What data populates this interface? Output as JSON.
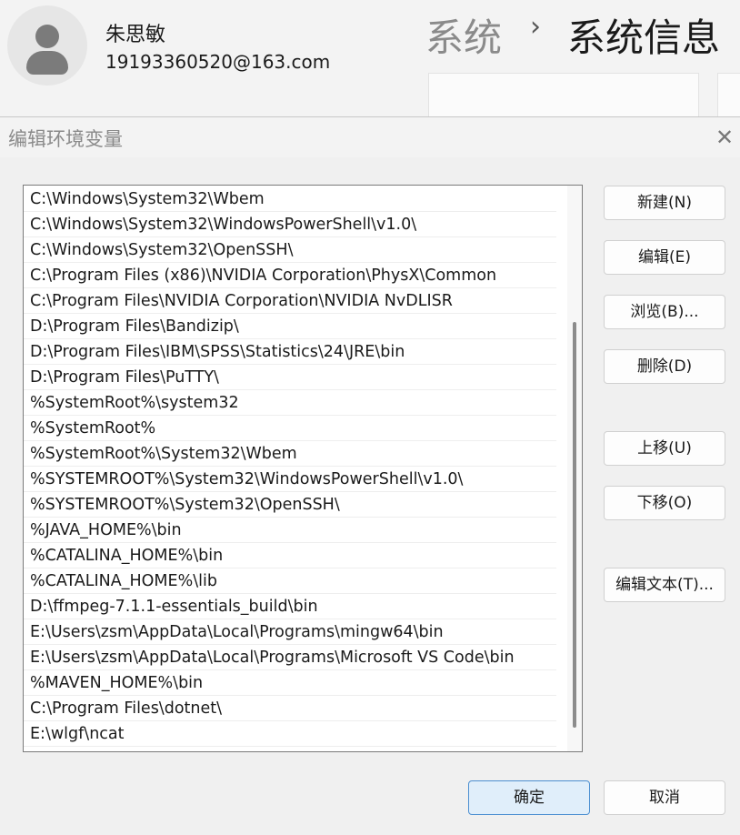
{
  "background": {
    "user": {
      "name": "朱思敏",
      "email": "19193360520@163.com",
      "avatar_icon": "person-icon"
    },
    "breadcrumb": {
      "parent": "系统",
      "separator": "›",
      "current": "系统信息"
    }
  },
  "dialog": {
    "title": "编辑环境变量",
    "close_icon": "close-icon",
    "paths": [
      "C:\\Windows\\System32\\Wbem",
      "C:\\Windows\\System32\\WindowsPowerShell\\v1.0\\",
      "C:\\Windows\\System32\\OpenSSH\\",
      "C:\\Program Files (x86)\\NVIDIA Corporation\\PhysX\\Common",
      "C:\\Program Files\\NVIDIA Corporation\\NVIDIA NvDLISR",
      "D:\\Program Files\\Bandizip\\",
      "D:\\Program Files\\IBM\\SPSS\\Statistics\\24\\JRE\\bin",
      "D:\\Program Files\\PuTTY\\",
      "%SystemRoot%\\system32",
      "%SystemRoot%",
      "%SystemRoot%\\System32\\Wbem",
      "%SYSTEMROOT%\\System32\\WindowsPowerShell\\v1.0\\",
      "%SYSTEMROOT%\\System32\\OpenSSH\\",
      "%JAVA_HOME%\\bin",
      "%CATALINA_HOME%\\bin",
      "%CATALINA_HOME%\\lib",
      "D:\\ffmpeg-7.1.1-essentials_build\\bin",
      "E:\\Users\\zsm\\AppData\\Local\\Programs\\mingw64\\bin",
      "E:\\Users\\zsm\\AppData\\Local\\Programs\\Microsoft VS Code\\bin",
      "%MAVEN_HOME%\\bin",
      "C:\\Program Files\\dotnet\\",
      "E:\\wlgf\\ncat"
    ],
    "buttons": {
      "new": "新建(N)",
      "edit": "编辑(E)",
      "browse": "浏览(B)...",
      "delete": "删除(D)",
      "move_up": "上移(U)",
      "move_down": "下移(O)",
      "edit_text": "编辑文本(T)...",
      "ok": "确定",
      "cancel": "取消"
    }
  },
  "colors": {
    "primary_button_bg": "#e0eefa",
    "primary_button_border": "#4c8fd1"
  }
}
